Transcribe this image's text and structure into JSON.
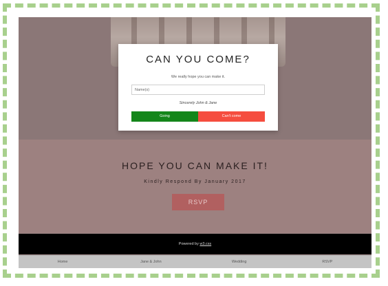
{
  "modal": {
    "title": "CAN YOU COME?",
    "subtitle": "We really hope you can make it.",
    "name_placeholder": "Name(s)",
    "signature": "Sincerely John & Jane",
    "going_label": "Going",
    "cant_label": "Can't come",
    "going_color": "#14861a",
    "cant_color": "#f54d3f"
  },
  "hope": {
    "title": "HOPE YOU CAN MAKE IT!",
    "subtitle": "Kindly Respond By January  2017",
    "rsvp_label": "RSVP"
  },
  "footer": {
    "prefix": "Powered by ",
    "link": "w3.css"
  },
  "nav": {
    "items": [
      "Home",
      "Jane & John",
      "Wedding",
      "RSVP"
    ]
  }
}
